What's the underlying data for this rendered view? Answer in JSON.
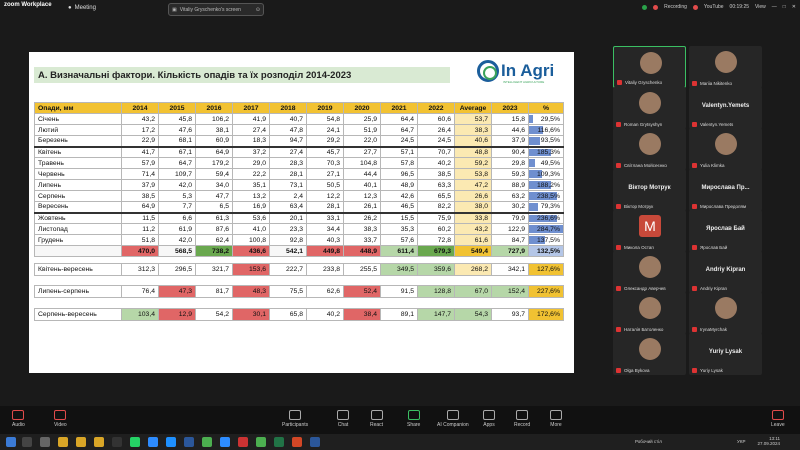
{
  "zoom": {
    "app_name": "zoom Workplace",
    "meeting_label": "Meeting",
    "screen_share_label": "Vitaliy Gryschenko's screen",
    "recording_label": "Recording",
    "youtube_label": "YouTube",
    "elapsed": "00:19:25",
    "view_label": "View"
  },
  "slide": {
    "title": "А. Визначальні фактори. Кількість опадів та їх розподіл 2014-2023",
    "brand_name": "In Agri",
    "brand_sub": "INTELLIGENT AGRICULTURE",
    "table": {
      "headers": [
        "Опади, мм",
        "2014",
        "2015",
        "2016",
        "2017",
        "2018",
        "2019",
        "2020",
        "2021",
        "2022",
        "Average",
        "2023",
        "%"
      ],
      "rows": [
        {
          "label": "Січень",
          "values": [
            "43,2",
            "45,8",
            "106,2",
            "41,9",
            "40,7",
            "54,8",
            "25,9",
            "64,4",
            "60,6",
            "53,7",
            "15,8"
          ],
          "pct": "29,5%",
          "pct_num": 29.5
        },
        {
          "label": "Лютий",
          "values": [
            "17,2",
            "47,6",
            "38,1",
            "27,4",
            "47,8",
            "24,1",
            "51,9",
            "64,7",
            "26,4",
            "38,3",
            "44,6"
          ],
          "pct": "116,6%",
          "pct_num": 116.6
        },
        {
          "label": "Березень",
          "values": [
            "22,9",
            "68,1",
            "60,9",
            "18,3",
            "94,7",
            "29,2",
            "22,0",
            "24,5",
            "24,5",
            "40,6",
            "37,9"
          ],
          "pct": "93,5%",
          "pct_num": 93.5
        },
        {
          "label": "Квітень",
          "values": [
            "41,7",
            "67,1",
            "64,9",
            "37,2",
            "27,4",
            "45,7",
            "27,7",
            "57,1",
            "70,7",
            "48,8",
            "90,4"
          ],
          "pct": "185,3%",
          "pct_num": 185.3
        },
        {
          "label": "Травень",
          "values": [
            "57,9",
            "64,7",
            "179,2",
            "29,0",
            "28,3",
            "70,3",
            "104,8",
            "57,8",
            "40,2",
            "59,2",
            "29,8"
          ],
          "pct": "49,5%",
          "pct_num": 49.5
        },
        {
          "label": "Червень",
          "values": [
            "71,4",
            "109,7",
            "59,4",
            "22,2",
            "28,1",
            "27,1",
            "44,4",
            "96,5",
            "38,5",
            "53,8",
            "59,3"
          ],
          "pct": "109,3%",
          "pct_num": 109.3
        },
        {
          "label": "Липень",
          "values": [
            "37,9",
            "42,0",
            "34,0",
            "35,1",
            "73,1",
            "50,5",
            "40,1",
            "48,9",
            "63,3",
            "47,2",
            "88,9"
          ],
          "pct": "188,2%",
          "pct_num": 188.2
        },
        {
          "label": "Серпень",
          "values": [
            "38,5",
            "5,3",
            "47,7",
            "13,2",
            "2,4",
            "12,2",
            "12,3",
            "42,6",
            "65,5",
            "26,6",
            "63,2"
          ],
          "pct": "238,5%",
          "pct_num": 238.5
        },
        {
          "label": "Вересень",
          "values": [
            "64,9",
            "7,7",
            "6,5",
            "16,9",
            "63,4",
            "28,1",
            "26,1",
            "46,5",
            "82,2",
            "38,0",
            "30,2"
          ],
          "pct": "79,3%",
          "pct_num": 79.3
        },
        {
          "label": "Жовтень",
          "values": [
            "11,5",
            "6,6",
            "61,3",
            "53,6",
            "20,1",
            "33,1",
            "26,2",
            "15,5",
            "75,9",
            "33,8",
            "79,9"
          ],
          "pct": "236,6%",
          "pct_num": 236.6
        },
        {
          "label": "Листопад",
          "values": [
            "11,2",
            "61,9",
            "87,6",
            "41,0",
            "23,3",
            "34,4",
            "38,3",
            "35,3",
            "60,2",
            "43,2",
            "122,9"
          ],
          "pct": "284,7%",
          "pct_num": 284.7
        },
        {
          "label": "Грудень",
          "values": [
            "51,8",
            "42,0",
            "62,4",
            "100,8",
            "92,8",
            "40,3",
            "33,7",
            "57,6",
            "72,8",
            "61,6",
            "84,7"
          ],
          "pct": "137,5%",
          "pct_num": 137.5
        }
      ],
      "total": {
        "label": "",
        "values": [
          "470,0",
          "568,5",
          "738,2",
          "436,6",
          "542,1",
          "449,8",
          "448,9",
          "611,4",
          "679,3",
          "549,4",
          "727,9"
        ],
        "pct": "132,5%"
      }
    },
    "summaries": [
      {
        "label": "Квітень-вересень",
        "values": [
          "312,3",
          "296,5",
          "321,7",
          "153,6",
          "222,7",
          "233,8",
          "255,5",
          "349,5",
          "359,6",
          "268,2",
          "342,1"
        ],
        "pct": "127,6%"
      },
      {
        "label": "Липень-серпень",
        "values": [
          "76,4",
          "47,3",
          "81,7",
          "48,3",
          "75,5",
          "62,6",
          "52,4",
          "91,5",
          "128,8",
          "67,0",
          "152,4"
        ],
        "pct": "227,6%"
      },
      {
        "label": "Серпень-вересень",
        "values": [
          "103,4",
          "12,9",
          "54,2",
          "30,1",
          "65,8",
          "40,2",
          "38,4",
          "89,1",
          "147,7",
          "54,3",
          "93,7"
        ],
        "pct": "172,6%"
      }
    ]
  },
  "participants": [
    {
      "name": "Vitaliy Gryschenko",
      "label": ""
    },
    {
      "name": "Mariia Nikitenko",
      "label": ""
    },
    {
      "name": "Roman Grytsyshyn",
      "label": ""
    },
    {
      "name": "Valentyn.Yemets",
      "label": "Valentyn.Yemets"
    },
    {
      "name": "Світлана Мойсеєнко",
      "label": ""
    },
    {
      "name": "Yulia Klimka",
      "label": ""
    },
    {
      "name": "Віктор Мотрук",
      "label": "Віктор Мотрук"
    },
    {
      "name": "Мирослава Предолям",
      "label": "Мирослава Пр..."
    },
    {
      "name": "Микола Остап",
      "label": "M"
    },
    {
      "name": "Ярослав Бай",
      "label": "Ярослав Бай"
    },
    {
      "name": "Олександр Аверчев",
      "label": ""
    },
    {
      "name": "Andriy Kipran",
      "label": "Andriy Kipran"
    },
    {
      "name": "Наталія Батоленко",
      "label": ""
    },
    {
      "name": "IrynaMyrchak",
      "label": ""
    },
    {
      "name": "Olga Bykova",
      "label": ""
    },
    {
      "name": "Yuriy Lysak",
      "label": "Yuriy Lysak"
    }
  ],
  "toolbar": {
    "audio": "Audio",
    "video": "Video",
    "participants": "Participants",
    "participants_count": "16",
    "chat": "Chat",
    "react": "React",
    "share": "Share",
    "ai": "AI Companion",
    "apps": "Apps",
    "record": "Record",
    "more": "More",
    "leave": "Leave"
  },
  "taskbar": {
    "desktop_label": "Робочий стіл",
    "lang": "УКР",
    "time": "13:11",
    "date": "27.09.2024"
  },
  "colors": {
    "header": "#f2c232",
    "average_col": "#fbe9b2",
    "red_cell": "#e06666",
    "green_cell": "#6aa84f",
    "light_green_cell": "#b6d7a8",
    "pct_bar": "#6f8fcf"
  }
}
